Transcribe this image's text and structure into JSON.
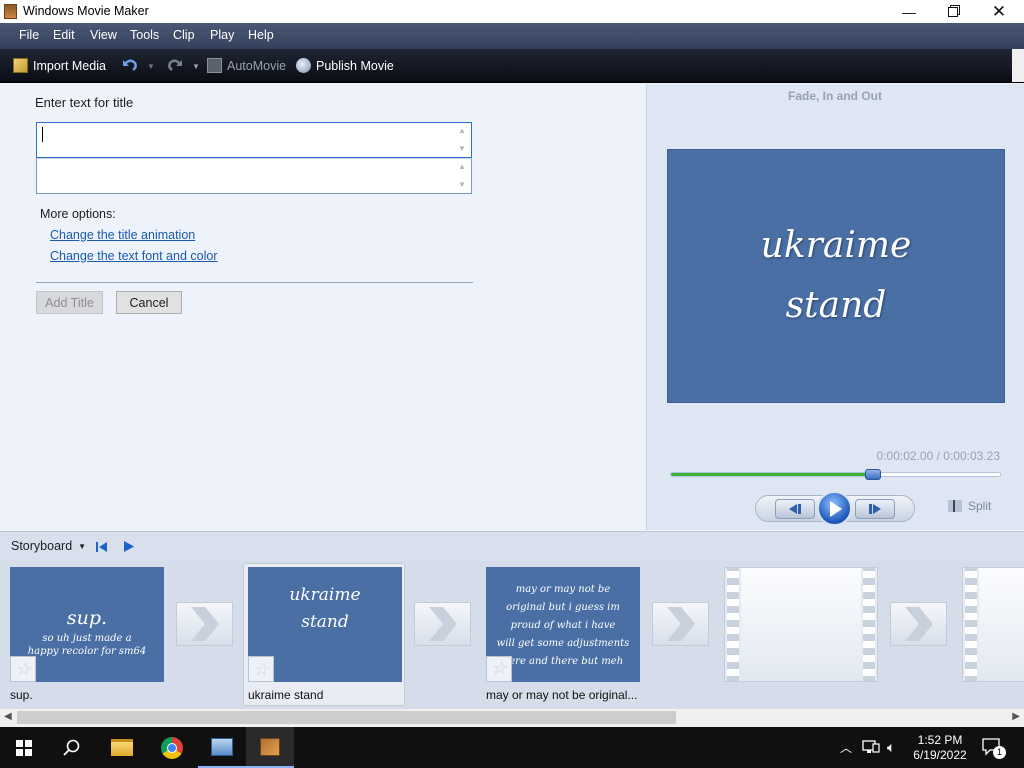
{
  "window": {
    "title": "Windows Movie Maker"
  },
  "menu": [
    "File",
    "Edit",
    "View",
    "Tools",
    "Clip",
    "Play",
    "Help"
  ],
  "toolbar": {
    "import_media": "Import Media",
    "automovie": "AutoMovie",
    "publish_movie": "Publish Movie"
  },
  "title_editor": {
    "heading": "Enter text for title",
    "line1_value": "",
    "line2_value": "",
    "more_options": "More options:",
    "link_animation": "Change the title animation",
    "link_font": "Change the text font and color",
    "add_title": "Add Title",
    "cancel": "Cancel"
  },
  "preview": {
    "effect_name": "Fade, In and Out",
    "line1": "ukraime",
    "line2": "stand",
    "time": "0:00:02.00 / 0:00:03.23",
    "progress": 0.61,
    "split": "Split"
  },
  "storyboard": {
    "label": "Storyboard",
    "clips": [
      {
        "name": "sup.",
        "line1": "sup.",
        "line2": "so uh just made a",
        "line3": "happy recolor for sm64"
      },
      {
        "name": "ukraime stand",
        "line1": "ukraime",
        "line2": "stand"
      },
      {
        "name": "may or may not be original...",
        "lines": [
          "may or may not be",
          "original but i guess im",
          "proud of what i have",
          "will get some adjustments",
          "here and there but meh"
        ]
      }
    ]
  },
  "taskbar": {
    "time": "1:52 PM",
    "date": "6/19/2022",
    "notification_count": "1"
  },
  "colors": {
    "accent": "#1a5bb0",
    "clip_bg": "#4a6fa5",
    "progress": "#3bb33b"
  }
}
